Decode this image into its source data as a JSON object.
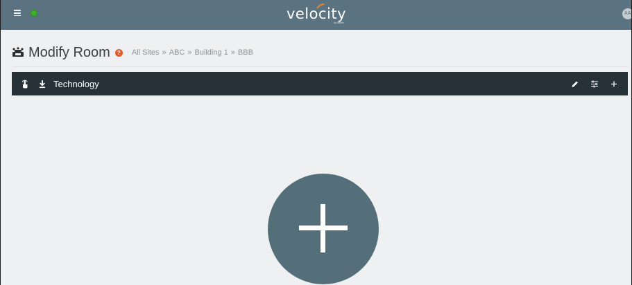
{
  "topbar": {
    "menu_icon": "hamburger-menu-icon",
    "status_icon": "globe-status-icon",
    "status_color": "#3fae2a",
    "logo_text": "velocity",
    "logo_subtext": "by Atlona",
    "logo_accent_color": "#f58220",
    "avatar_initials": "AA",
    "background_color": "#5b7381"
  },
  "heading": {
    "icon": "room-icon",
    "title": "Modify Room",
    "help_icon": "help-icon",
    "help_color": "#e05a2b",
    "breadcrumb": {
      "items": [
        "All Sites",
        "ABC",
        "Building 1",
        "BBB"
      ],
      "separator": "»"
    }
  },
  "section": {
    "title": "Technology",
    "background_color": "#263237",
    "left_icons": [
      "touch-icon",
      "download-icon"
    ],
    "right_icons": [
      "edit-pencil-icon",
      "settings-sliders-icon",
      "add-plus-icon"
    ]
  },
  "main": {
    "add_button_icon": "plus-icon",
    "add_button_color": "#546e7a"
  }
}
